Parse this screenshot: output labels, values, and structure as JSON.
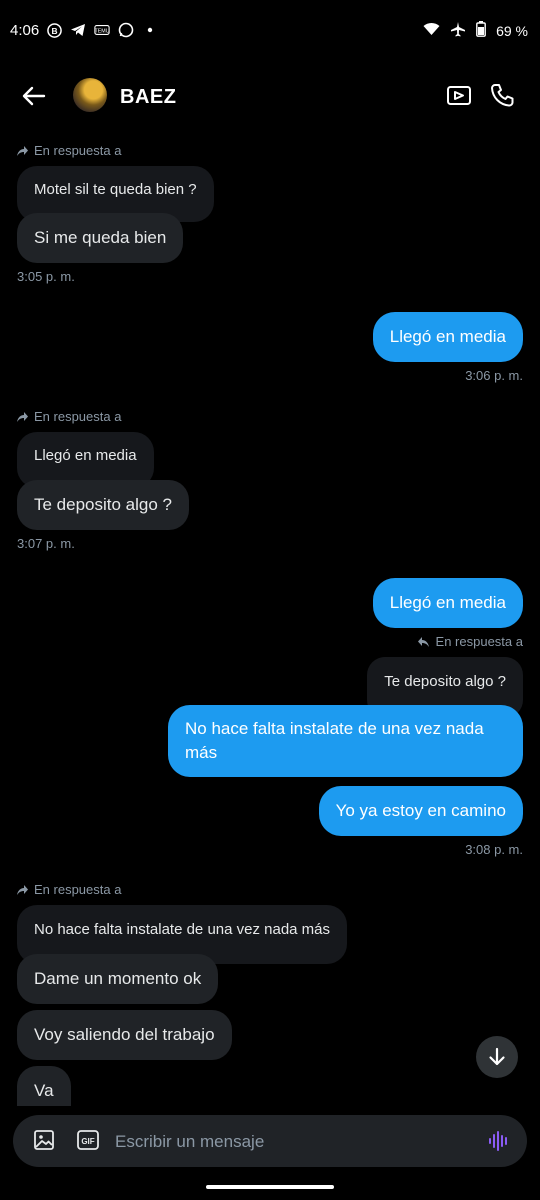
{
  "status_bar": {
    "time": "4:06",
    "battery": "69 %"
  },
  "header": {
    "contact_name": "BAEZ"
  },
  "reply_label": "En respuesta a",
  "messages": {
    "m1_quote": "Motel sil te queda bien ?",
    "m1_text": "Si me queda bien",
    "m1_time": "3:05 p. m.",
    "m2_text": "Llegó en media",
    "m2_time": "3:06 p. m.",
    "m3_quote": "Llegó en media",
    "m3_text": "Te deposito algo ?",
    "m3_time": "3:07 p. m.",
    "m4_text": "Llegó en media",
    "m5_quote": "Te deposito algo ?",
    "m5_text": "No hace falta instalate de una vez nada más",
    "m6_text": "Yo ya estoy en camino",
    "m6_time": "3:08 p. m.",
    "m7_quote": "No hace falta instalate de una vez nada más",
    "m7_text": "Dame un momento ok",
    "m8_text": "Voy saliendo del trabajo",
    "m9_text": "Va"
  },
  "composer": {
    "placeholder": "Escribir un mensaje"
  },
  "colors": {
    "accent": "#1d9bf0",
    "incoming_bubble": "#202327",
    "background": "#000000"
  }
}
